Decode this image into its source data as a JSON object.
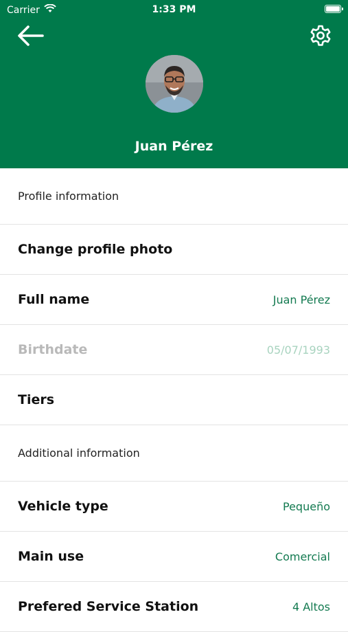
{
  "status_bar": {
    "carrier": "Carrier",
    "time": "1:33 PM"
  },
  "header": {
    "user_name": "Juan Pérez"
  },
  "sections": [
    {
      "title": "Profile information",
      "rows": [
        {
          "label": "Change profile photo",
          "value": ""
        },
        {
          "label": "Full name",
          "value": "Juan Pérez"
        },
        {
          "label": "Birthdate",
          "value": "05/07/1993",
          "disabled": true
        },
        {
          "label": "Tiers",
          "value": ""
        }
      ]
    },
    {
      "title": "Additional information",
      "rows": [
        {
          "label": "Vehicle type",
          "value": "Pequeño"
        },
        {
          "label": "Main use",
          "value": "Comercial"
        },
        {
          "label": "Prefered Service Station",
          "value": "4 Altos"
        }
      ]
    }
  ],
  "colors": {
    "brand_green": "#007a4b",
    "value_green": "#137a50"
  },
  "icons": {
    "back": "arrow-left-icon",
    "settings": "gear-icon",
    "wifi": "wifi-icon",
    "battery": "battery-icon"
  }
}
